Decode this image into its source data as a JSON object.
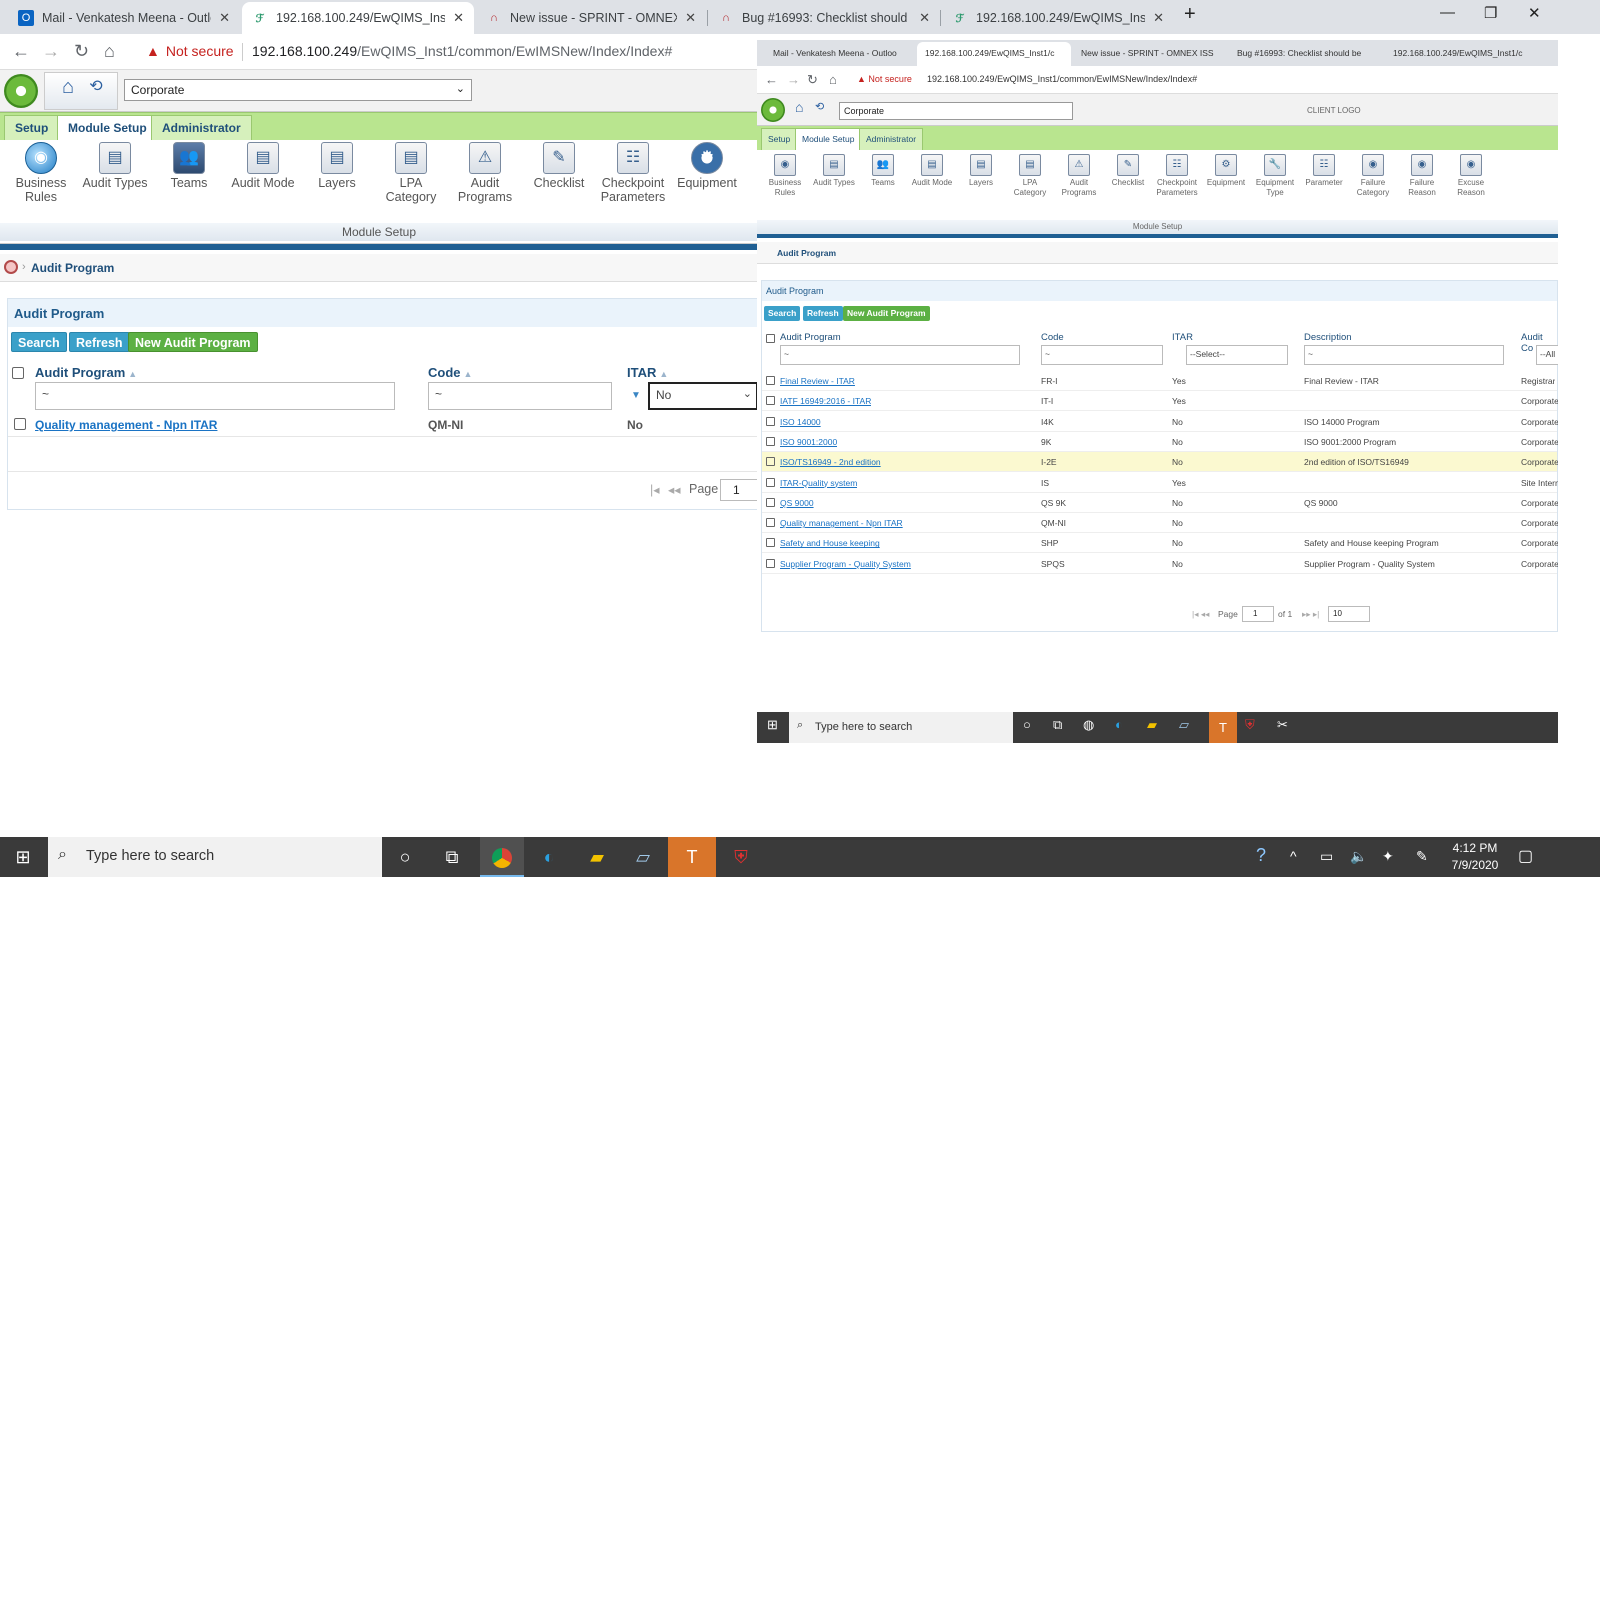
{
  "browser": {
    "tabs": [
      {
        "title": "Mail - Venkatesh Meena - Outlo",
        "icon": "outlook-icon",
        "active": false
      },
      {
        "title": "192.168.100.249/EwQIMS_Inst1/c",
        "icon": "app-icon",
        "active": true
      },
      {
        "title": "New issue - SPRINT - OMNEX ISS",
        "icon": "redmine-icon",
        "active": false
      },
      {
        "title": "Bug #16993: Checklist should be",
        "icon": "redmine-icon",
        "active": false
      },
      {
        "title": "192.168.100.249/EwQIMS_Inst1/c",
        "icon": "app-icon",
        "active": false
      }
    ],
    "security_label": "Not secure",
    "url_host": "192.168.100.249",
    "url_path": "/EwQIMS_Inst1/common/EwIMSNew/Index/Index#"
  },
  "app": {
    "org_select": "Corporate",
    "tabs": [
      "Setup",
      "Module Setup",
      "Administrator"
    ],
    "active_tab": "Module Setup",
    "ribbon": [
      {
        "label": "Business Rules",
        "icon": "globe-icon"
      },
      {
        "label": "Audit Types",
        "icon": "clipboard-icon"
      },
      {
        "label": "Teams",
        "icon": "people-icon"
      },
      {
        "label": "Audit Mode",
        "icon": "clipboard-icon"
      },
      {
        "label": "Layers",
        "icon": "clipboard-icon"
      },
      {
        "label": "LPA Category",
        "icon": "clipboard-icon"
      },
      {
        "label": "Audit Programs",
        "icon": "clipboard-warning-icon"
      },
      {
        "label": "Checklist",
        "icon": "checklist-icon"
      },
      {
        "label": "Checkpoint Parameters",
        "icon": "list-icon"
      },
      {
        "label": "Equipment",
        "icon": "gear-icon"
      }
    ],
    "ribbon_caption": "Module Setup",
    "breadcrumb": "Audit Program",
    "panel": {
      "title": "Audit Program",
      "buttons": {
        "search": "Search",
        "refresh": "Refresh",
        "new": "New Audit Program"
      },
      "columns": {
        "program": "Audit Program",
        "code": "Code",
        "itar": "ITAR"
      },
      "filters": {
        "program": "~",
        "code": "~",
        "itar": "No"
      },
      "rows": [
        {
          "program": "Quality management - Npn ITAR",
          "code": "QM-NI",
          "itar": "No"
        }
      ],
      "pager": {
        "label": "Page",
        "value": "1"
      }
    }
  },
  "taskbar": {
    "search_placeholder": "Type here to search",
    "time": "4:12 PM",
    "date": "7/9/2020"
  },
  "right_window": {
    "tabs": [
      "Mail - Venkatesh Meena - Outloo",
      "192.168.100.249/EwQIMS_Inst1/c",
      "New issue - SPRINT - OMNEX ISS",
      "Bug #16993: Checklist should be",
      "192.168.100.249/EwQIMS_Inst1/c"
    ],
    "security_label": "Not secure",
    "url": "192.168.100.249/EwQIMS_Inst1/common/EwIMSNew/Index/Index#",
    "org_select": "Corporate",
    "client_logo": "CLIENT LOGO",
    "mod_tabs": [
      "Setup",
      "Module Setup",
      "Administrator"
    ],
    "ribbon": [
      "Business Rules",
      "Audit Types",
      "Teams",
      "Audit Mode",
      "Layers",
      "LPA Category",
      "Audit Programs",
      "Checklist",
      "Checkpoint Parameters",
      "Equipment",
      "Equipment Type",
      "Parameter",
      "Failure Category",
      "Failure Reason",
      "Excuse Reason"
    ],
    "ribbon_caption": "Module Setup",
    "breadcrumb": "Audit Program",
    "panel_title": "Audit Program",
    "buttons": {
      "search": "Search",
      "refresh": "Refresh",
      "new": "New Audit Program"
    },
    "columns": {
      "program": "Audit Program",
      "code": "Code",
      "itar": "ITAR",
      "description": "Description",
      "audit_co": "Audit Co"
    },
    "filters": {
      "program": "~",
      "code": "~",
      "itar": "--Select--",
      "description": "~",
      "audit_co": "--All"
    },
    "rows": [
      {
        "program": "Final Review - ITAR",
        "code": "FR-I",
        "itar": "Yes",
        "description": "Final Review - ITAR",
        "audit_co": "Registrar"
      },
      {
        "program": "IATF 16949:2016 - ITAR",
        "code": "IT-I",
        "itar": "Yes",
        "description": "",
        "audit_co": "Corporate"
      },
      {
        "program": "ISO 14000",
        "code": "I4K",
        "itar": "No",
        "description": "ISO 14000 Program",
        "audit_co": "Corporate"
      },
      {
        "program": "ISO 9001:2000",
        "code": "9K",
        "itar": "No",
        "description": "ISO 9001:2000 Program",
        "audit_co": "Corporate"
      },
      {
        "program": "ISO/TS16949 - 2nd edition",
        "code": "I-2E",
        "itar": "No",
        "description": "2nd edition of ISO/TS16949",
        "audit_co": "Corporate"
      },
      {
        "program": "ITAR-Quality system",
        "code": "IS",
        "itar": "Yes",
        "description": "",
        "audit_co": "Site Intern"
      },
      {
        "program": "QS 9000",
        "code": "QS 9K",
        "itar": "No",
        "description": "QS 9000",
        "audit_co": "Corporate"
      },
      {
        "program": "Quality management - Npn ITAR",
        "code": "QM-NI",
        "itar": "No",
        "description": "",
        "audit_co": "Corporate"
      },
      {
        "program": "Safety and House keeping",
        "code": "SHP",
        "itar": "No",
        "description": "Safety and House keeping Program",
        "audit_co": "Corporate"
      },
      {
        "program": "Supplier Program - Quality System",
        "code": "SPQS",
        "itar": "No",
        "description": "Supplier Program - Quality System",
        "audit_co": "Corporate"
      }
    ],
    "pager": {
      "label": "Page",
      "value": "1",
      "of": "of 1",
      "size": "10"
    },
    "taskbar_search": "Type here to search"
  }
}
